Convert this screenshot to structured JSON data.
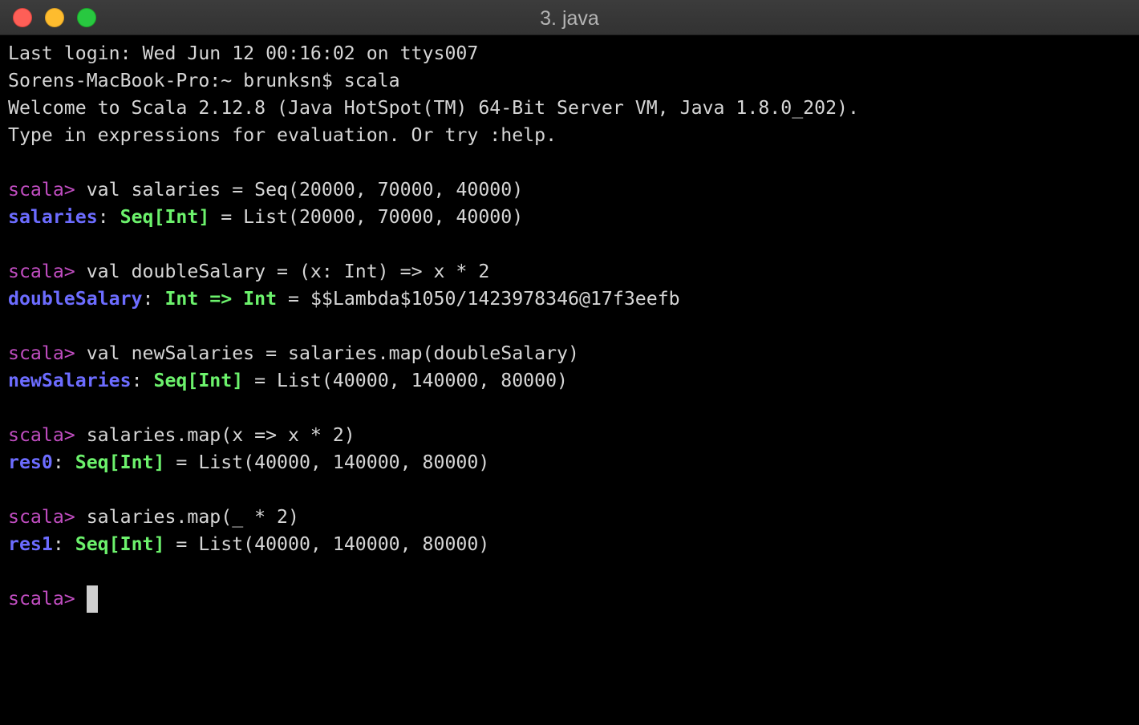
{
  "window": {
    "title": "3. java"
  },
  "terminal": {
    "intro": [
      "Last login: Wed Jun 12 00:16:02 on ttys007",
      "Sorens-MacBook-Pro:~ brunksn$ scala",
      "Welcome to Scala 2.12.8 (Java HotSpot(TM) 64-Bit Server VM, Java 1.8.0_202).",
      "Type in expressions for evaluation. Or try :help."
    ],
    "prompt": "scala>",
    "entries": [
      {
        "input": " val salaries = Seq(20000, 70000, 40000)",
        "result_name": "salaries",
        "result_sep": ": ",
        "result_type": "Seq[Int]",
        "result_value": " = List(20000, 70000, 40000)"
      },
      {
        "input": " val doubleSalary = (x: Int) => x * 2",
        "result_name": "doubleSalary",
        "result_sep": ": ",
        "result_type": "Int => Int",
        "result_value": " = $$Lambda$1050/1423978346@17f3eefb"
      },
      {
        "input": " val newSalaries = salaries.map(doubleSalary)",
        "result_name": "newSalaries",
        "result_sep": ": ",
        "result_type": "Seq[Int]",
        "result_value": " = List(40000, 140000, 80000)"
      },
      {
        "input": " salaries.map(x => x * 2)",
        "result_name": "res0",
        "result_sep": ": ",
        "result_type": "Seq[Int]",
        "result_value": " = List(40000, 140000, 80000)"
      },
      {
        "input": " salaries.map(_ * 2)",
        "result_name": "res1",
        "result_sep": ": ",
        "result_type": "Seq[Int]",
        "result_value": " = List(40000, 140000, 80000)"
      }
    ],
    "current_prompt": "scala>"
  },
  "colors": {
    "background": "#000000",
    "text": "#d6d6d6",
    "prompt": "#c04dc0",
    "identifier": "#6c6cff",
    "type": "#6cf26c",
    "cursor": "#cfcfcf"
  }
}
